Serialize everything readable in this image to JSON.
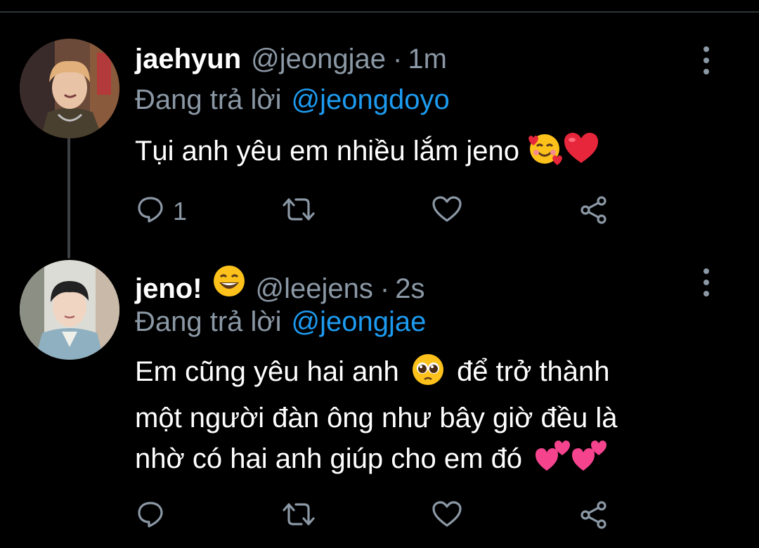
{
  "tweets": [
    {
      "display_name": "jaehyun",
      "handle": "@jeongjae",
      "separator": "·",
      "time": "1m",
      "reply_prefix": "Đang trả lời",
      "reply_to": "@jeongdoyo",
      "text": "Tụi anh yêu em nhiều lắm jeno",
      "text_emojis": [
        "smiling-face-with-hearts",
        "red-heart"
      ],
      "actions": {
        "reply_count": "1",
        "retweet_count": "",
        "like_count": ""
      }
    },
    {
      "display_name": "jeno!",
      "name_emoji": "grinning-squinting-face",
      "handle": "@leejens",
      "separator": "·",
      "time": "2s",
      "reply_prefix": "Đang trả lời",
      "reply_to": "@jeongjae",
      "text_line1_a": "Em cũng yêu hai anh",
      "text_line1_emoji": "pleading-face",
      "text_line1_b": "để trở thành",
      "text_line2": "một người đàn ông như bây giờ đều là",
      "text_line3": "nhờ có hai anh giúp cho em đó",
      "text_emojis": [
        "two-hearts",
        "two-hearts"
      ],
      "actions": {
        "reply_count": "",
        "retweet_count": "",
        "like_count": ""
      }
    }
  ],
  "colors": {
    "background": "#000000",
    "primary_text": "#ffffff",
    "secondary_text": "#8b98a5",
    "mention": "#1d9bf0",
    "divider": "#2f3336"
  }
}
